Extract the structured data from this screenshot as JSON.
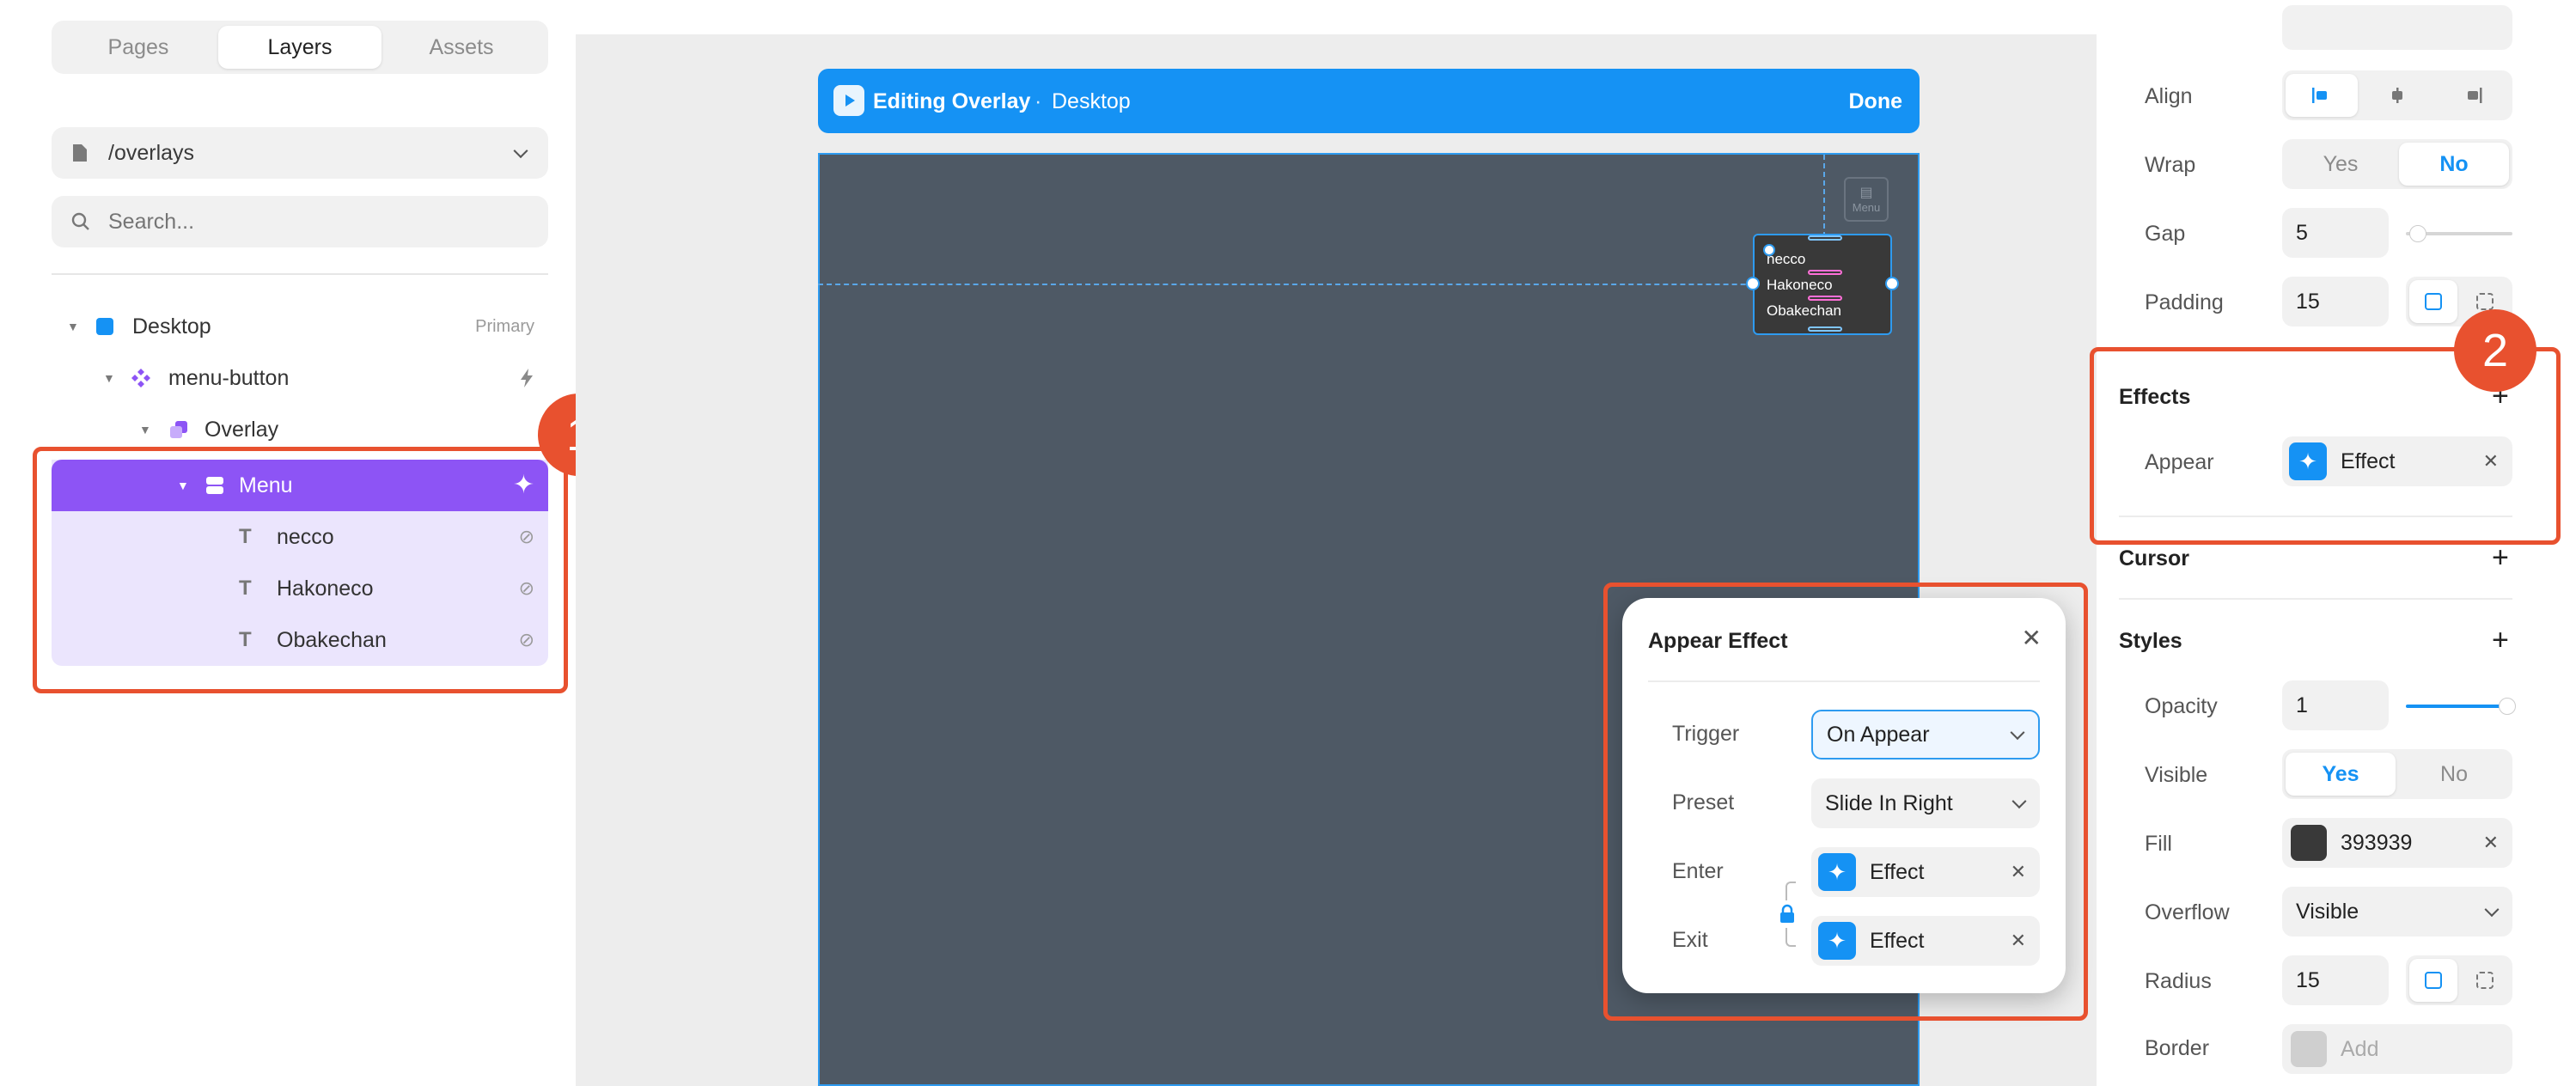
{
  "left_panel": {
    "tabs": [
      "Pages",
      "Layers",
      "Assets"
    ],
    "active_tab": "Layers",
    "path": "/overlays",
    "search_placeholder": "Search...",
    "layers": [
      {
        "name": "Desktop",
        "tag": "Primary",
        "icon": "frame-icon"
      },
      {
        "name": "menu-button",
        "icon": "component-icon",
        "action_icon": "lightning-icon"
      },
      {
        "name": "Overlay",
        "icon": "overlay-icon"
      },
      {
        "name": "Menu",
        "icon": "stack-icon",
        "selected": true
      },
      {
        "name": "necco",
        "icon": "text-icon",
        "action_icon": "link-icon"
      },
      {
        "name": "Hakoneco",
        "icon": "text-icon",
        "action_icon": "link-icon"
      },
      {
        "name": "Obakechan",
        "icon": "text-icon",
        "action_icon": "link-icon"
      }
    ]
  },
  "callouts": {
    "one": "1",
    "two": "2"
  },
  "canvas": {
    "topbar_title": "Editing Overlay",
    "topbar_separator": "·",
    "topbar_breakpoint": "Desktop",
    "topbar_done": "Done",
    "menu_icon_label": "Menu",
    "menu_items": [
      "necco",
      "Hakoneco",
      "Obakechan"
    ]
  },
  "popup": {
    "title": "Appear Effect",
    "trigger_label": "Trigger",
    "trigger_value": "On Appear",
    "preset_label": "Preset",
    "preset_value": "Slide In Right",
    "enter_label": "Enter",
    "enter_value": "Effect",
    "exit_label": "Exit",
    "exit_value": "Effect"
  },
  "right_panel": {
    "align_label": "Align",
    "wrap_label": "Wrap",
    "wrap_yes": "Yes",
    "wrap_no": "No",
    "gap_label": "Gap",
    "gap_value": "5",
    "padding_label": "Padding",
    "padding_value": "15",
    "effects_title": "Effects",
    "appear_label": "Appear",
    "appear_value": "Effect",
    "cursor_title": "Cursor",
    "styles_title": "Styles",
    "opacity_label": "Opacity",
    "opacity_value": "1",
    "visible_label": "Visible",
    "visible_yes": "Yes",
    "visible_no": "No",
    "fill_label": "Fill",
    "fill_value": "393939",
    "fill_color": "#393939",
    "overflow_label": "Overflow",
    "overflow_value": "Visible",
    "radius_label": "Radius",
    "radius_value": "15",
    "border_label": "Border",
    "border_value": "Add"
  },
  "colors": {
    "accent": "#1592f4",
    "selection": "#8d54f5",
    "callout": "#e8512f",
    "canvas_frame": "#4e5965"
  }
}
